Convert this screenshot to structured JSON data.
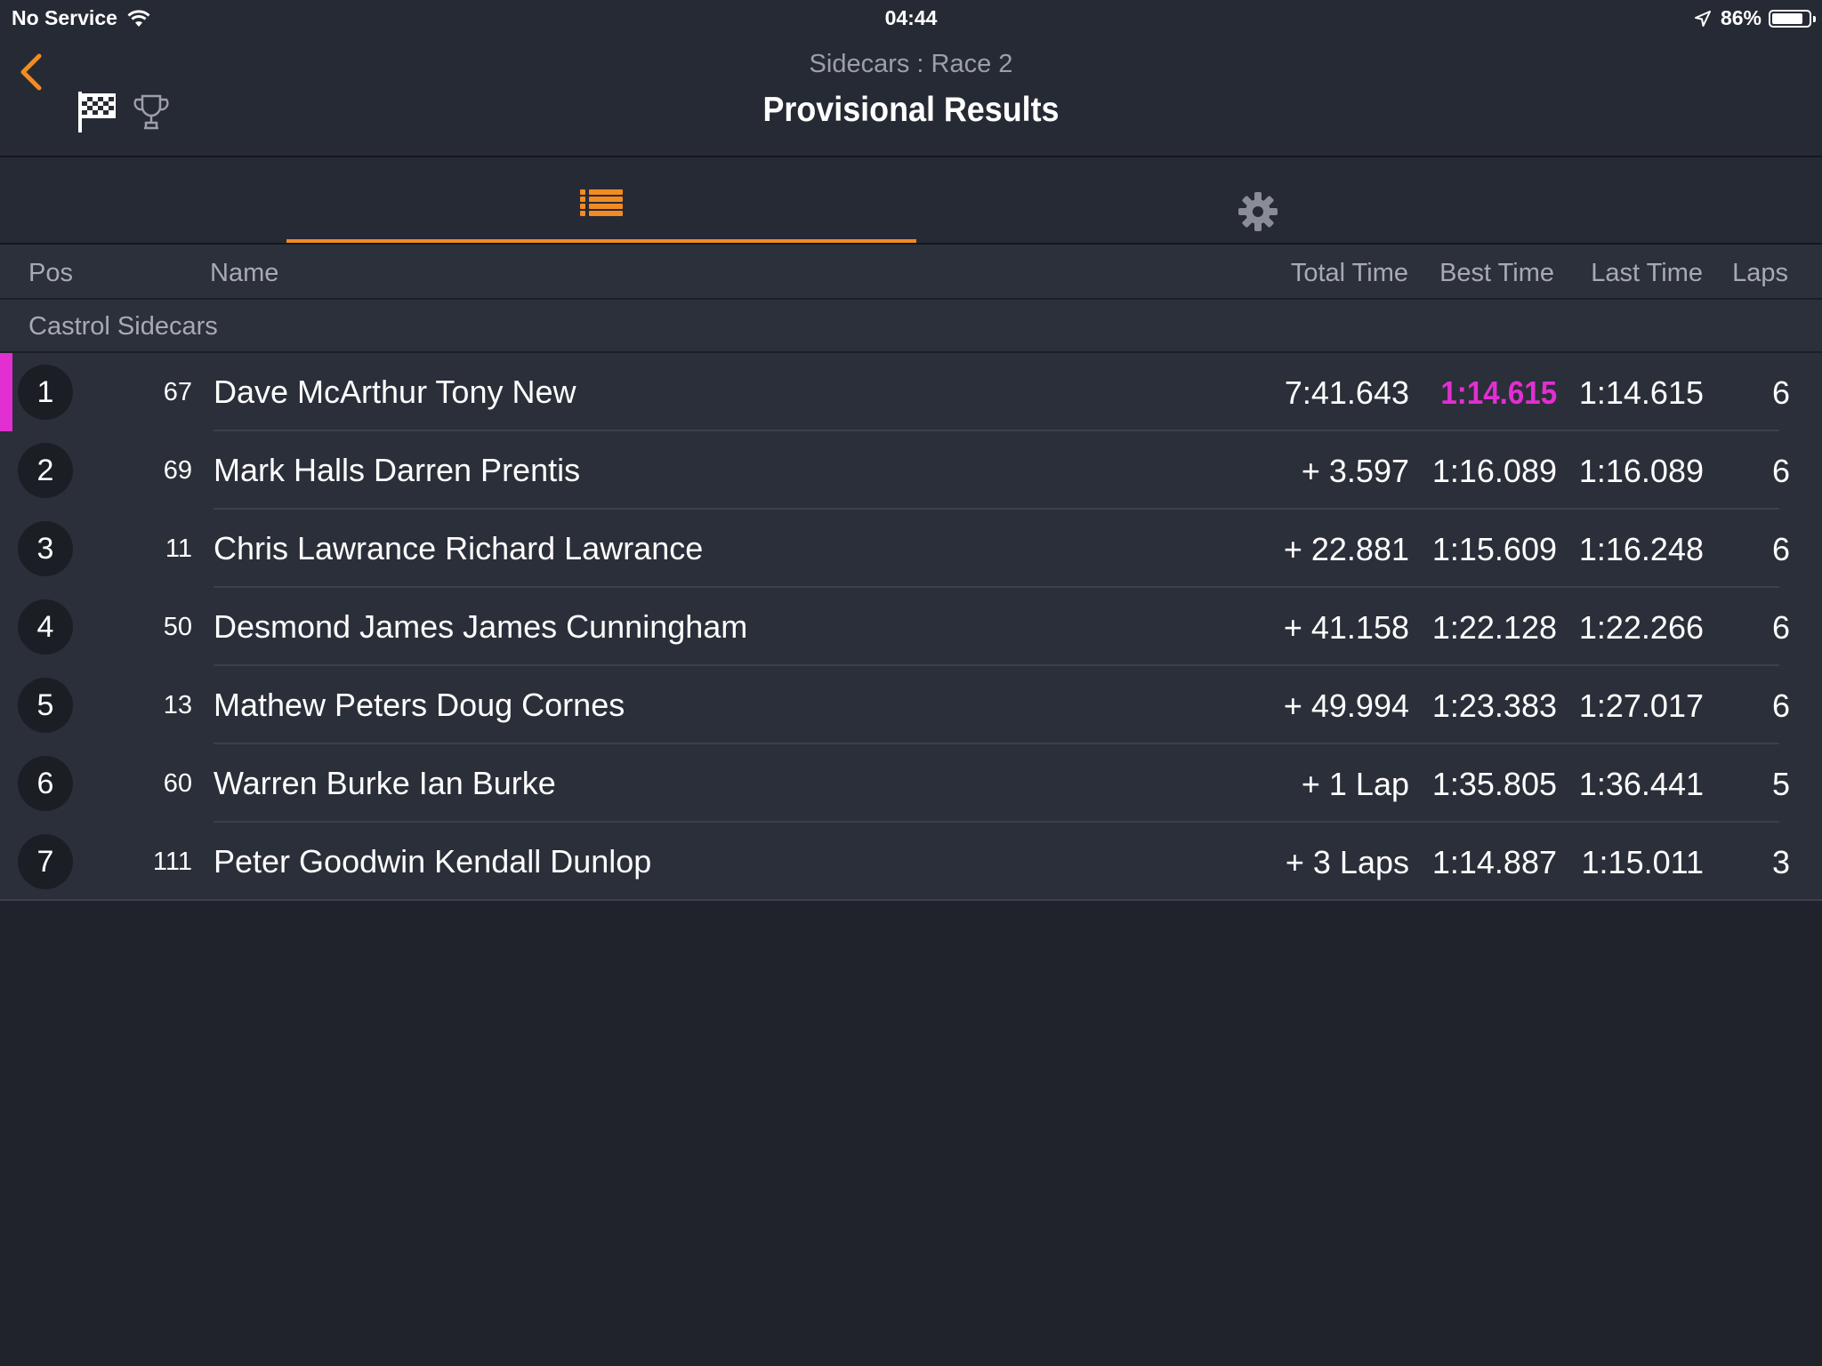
{
  "status_bar": {
    "carrier": "No Service",
    "time": "04:44",
    "battery_percent": "86%",
    "battery_level": 0.86
  },
  "header": {
    "subtitle": "Sidecars : Race 2",
    "title": "Provisional Results"
  },
  "tabs": [
    {
      "name": "results-list",
      "icon": "list-icon",
      "selected": true
    },
    {
      "name": "settings",
      "icon": "gear-icon",
      "selected": false
    }
  ],
  "columns": {
    "pos": "Pos",
    "name": "Name",
    "total_time": "Total Time",
    "best_time": "Best Time",
    "last_time": "Last Time",
    "laps": "Laps"
  },
  "group": "Castrol Sidecars",
  "colors": {
    "accent": "#f28b22",
    "fastest_lap": "#e12fd2",
    "background": "#20232c"
  },
  "results": [
    {
      "pos": "1",
      "number": "67",
      "name": "Dave McArthur Tony New",
      "total": "7:41.643",
      "best": "1:14.615",
      "last": "1:14.615",
      "laps": "6",
      "fastest": true
    },
    {
      "pos": "2",
      "number": "69",
      "name": "Mark Halls Darren Prentis",
      "total": "+ 3.597",
      "best": "1:16.089",
      "last": "1:16.089",
      "laps": "6",
      "fastest": false
    },
    {
      "pos": "3",
      "number": "11",
      "name": "Chris Lawrance Richard Lawrance",
      "total": "+ 22.881",
      "best": "1:15.609",
      "last": "1:16.248",
      "laps": "6",
      "fastest": false
    },
    {
      "pos": "4",
      "number": "50",
      "name": "Desmond James James Cunningham",
      "total": "+ 41.158",
      "best": "1:22.128",
      "last": "1:22.266",
      "laps": "6",
      "fastest": false
    },
    {
      "pos": "5",
      "number": "13",
      "name": "Mathew Peters Doug Cornes",
      "total": "+ 49.994",
      "best": "1:23.383",
      "last": "1:27.017",
      "laps": "6",
      "fastest": false
    },
    {
      "pos": "6",
      "number": "60",
      "name": "Warren Burke Ian Burke",
      "total": "+ 1 Lap",
      "best": "1:35.805",
      "last": "1:36.441",
      "laps": "5",
      "fastest": false
    },
    {
      "pos": "7",
      "number": "111",
      "name": "Peter Goodwin Kendall Dunlop",
      "total": "+ 3 Laps",
      "best": "1:14.887",
      "last": "1:15.011",
      "laps": "3",
      "fastest": false
    }
  ]
}
